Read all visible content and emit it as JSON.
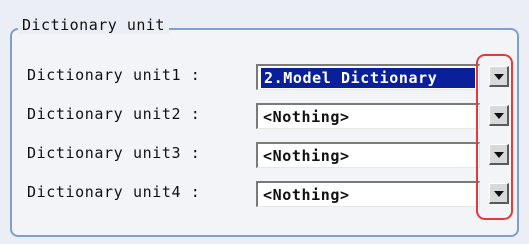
{
  "group": {
    "title": "Dictionary unit"
  },
  "rows": [
    {
      "label": "Dictionary unit1 :",
      "value": "2.Model Dictionary",
      "selected": true
    },
    {
      "label": "Dictionary unit2 :",
      "value": "<Nothing>",
      "selected": false
    },
    {
      "label": "Dictionary unit3 :",
      "value": "<Nothing>",
      "selected": false
    },
    {
      "label": "Dictionary unit4 :",
      "value": "<Nothing>",
      "selected": false
    }
  ],
  "icons": {
    "dropdown": "chevron-down-icon"
  },
  "colors": {
    "selection": "#0a1f9a",
    "highlight": "#e53a3a",
    "group_border": "#7f9fd0"
  }
}
